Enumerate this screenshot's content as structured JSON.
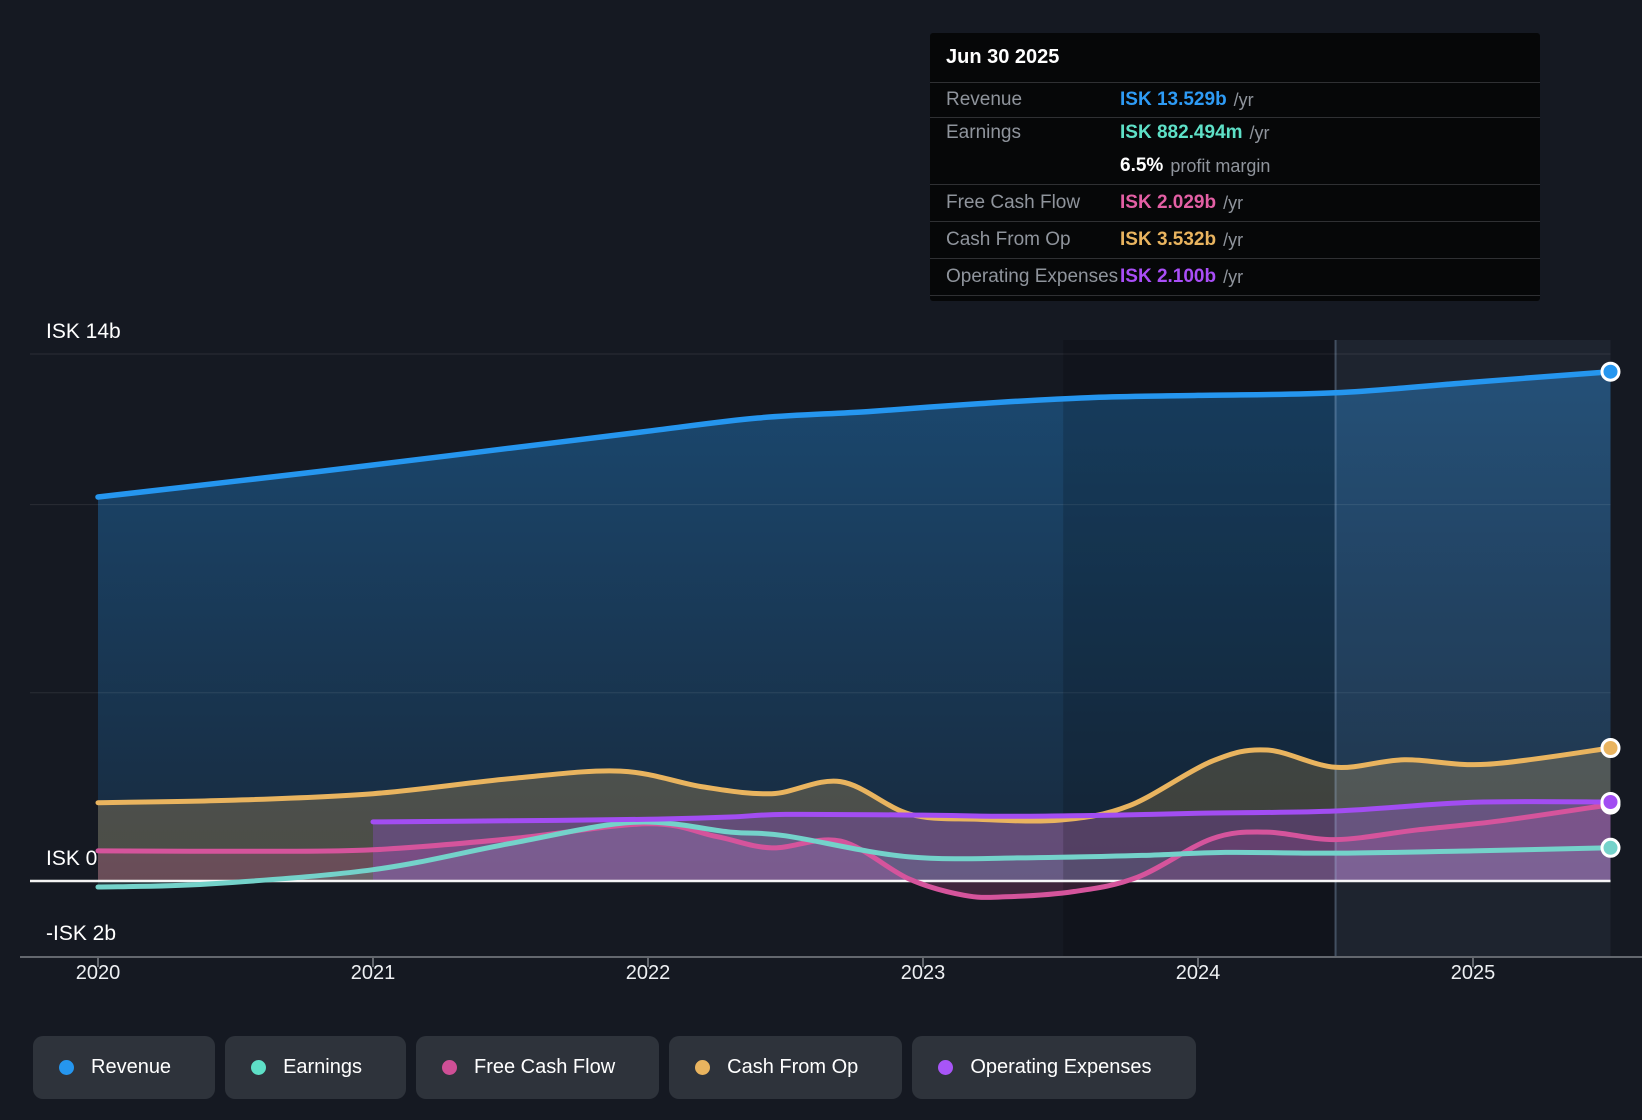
{
  "page": {
    "background": "#151922"
  },
  "tooltip": {
    "date": "Jun 30 2025",
    "rows": [
      {
        "key": "revenue",
        "label": "Revenue",
        "value": "ISK 13.529b",
        "suffix": "/yr",
        "color": "#2e9bf5"
      },
      {
        "key": "earnings",
        "label": "Earnings",
        "value": "ISK 882.494m",
        "suffix": "/yr",
        "color": "#5ee0c7"
      },
      {
        "key": "profit-margin",
        "label": "",
        "value": "6.5%",
        "suffix": "profit margin",
        "color": "#ffffff"
      },
      {
        "key": "free-cash-flow",
        "label": "Free Cash Flow",
        "value": "ISK 2.029b",
        "suffix": "/yr",
        "color": "#e35fa4"
      },
      {
        "key": "cash-from-op",
        "label": "Cash From Op",
        "value": "ISK 3.532b",
        "suffix": "/yr",
        "color": "#e9b45f"
      },
      {
        "key": "operating-expenses",
        "label": "Operating Expenses",
        "value": "ISK 2.100b",
        "suffix": "/yr",
        "color": "#a94ef7"
      }
    ]
  },
  "axis": {
    "y_labels": [
      {
        "text": "ISK 14b",
        "value": 14
      },
      {
        "text": "ISK 0",
        "value": 0
      },
      {
        "text": "-ISK 2b",
        "value": -2
      }
    ],
    "x_labels": [
      {
        "text": "2020",
        "year": 2020
      },
      {
        "text": "2021",
        "year": 2021
      },
      {
        "text": "2022",
        "year": 2022
      },
      {
        "text": "2023",
        "year": 2023
      },
      {
        "text": "2024",
        "year": 2024
      },
      {
        "text": "2025",
        "year": 2025
      }
    ]
  },
  "legend": {
    "items": [
      {
        "label": "Revenue",
        "color": "#2596ef"
      },
      {
        "label": "Earnings",
        "color": "#5ee0c7"
      },
      {
        "label": "Free Cash Flow",
        "color": "#cf4f96"
      },
      {
        "label": "Cash From Op",
        "color": "#e9b45f"
      },
      {
        "label": "Operating Expenses",
        "color": "#a855f7"
      }
    ]
  },
  "chart_data": {
    "type": "line",
    "unit": "ISK billions per year",
    "x_range": [
      2020,
      2025.5
    ],
    "ylim": [
      -2,
      14.5
    ],
    "y_gridlines": [
      14,
      10,
      5,
      0
    ],
    "grid": "horizontal-only",
    "legend_position": "bottom-left",
    "end_label_date": "Jun 30 2025",
    "highlight_band": {
      "from": 2024.5,
      "to": 2025.5
    },
    "dim_band": {
      "from": 2023.51,
      "to": 2024.5
    },
    "series": [
      {
        "name": "Revenue",
        "color": "#2596ef",
        "points": [
          [
            2020,
            10.2
          ],
          [
            2020.5,
            10.62
          ],
          [
            2021,
            11.05
          ],
          [
            2021.5,
            11.5
          ],
          [
            2022,
            11.95
          ],
          [
            2022.4,
            12.3
          ],
          [
            2022.8,
            12.47
          ],
          [
            2023.2,
            12.68
          ],
          [
            2023.6,
            12.84
          ],
          [
            2024,
            12.9
          ],
          [
            2024.5,
            12.97
          ],
          [
            2025,
            13.25
          ],
          [
            2025.5,
            13.529
          ]
        ]
      },
      {
        "name": "Cash From Op",
        "color": "#e9b45f",
        "points": [
          [
            2020,
            2.08
          ],
          [
            2020.5,
            2.15
          ],
          [
            2021,
            2.32
          ],
          [
            2021.5,
            2.72
          ],
          [
            2021.9,
            2.92
          ],
          [
            2022.2,
            2.5
          ],
          [
            2022.45,
            2.32
          ],
          [
            2022.7,
            2.64
          ],
          [
            2022.95,
            1.78
          ],
          [
            2023.2,
            1.64
          ],
          [
            2023.5,
            1.62
          ],
          [
            2023.75,
            2.0
          ],
          [
            2024.05,
            3.18
          ],
          [
            2024.25,
            3.48
          ],
          [
            2024.5,
            3.02
          ],
          [
            2024.75,
            3.22
          ],
          [
            2025.05,
            3.1
          ],
          [
            2025.5,
            3.532
          ]
        ]
      },
      {
        "name": "Free Cash Flow",
        "color": "#d5549c",
        "points": [
          [
            2020,
            0.8
          ],
          [
            2020.6,
            0.79
          ],
          [
            2021,
            0.83
          ],
          [
            2021.5,
            1.12
          ],
          [
            2022,
            1.52
          ],
          [
            2022.25,
            1.18
          ],
          [
            2022.45,
            0.88
          ],
          [
            2022.7,
            1.06
          ],
          [
            2022.95,
            0.05
          ],
          [
            2023.15,
            -0.38
          ],
          [
            2023.3,
            -0.42
          ],
          [
            2023.55,
            -0.28
          ],
          [
            2023.78,
            0.1
          ],
          [
            2024.05,
            1.12
          ],
          [
            2024.25,
            1.3
          ],
          [
            2024.5,
            1.1
          ],
          [
            2024.8,
            1.36
          ],
          [
            2025.1,
            1.6
          ],
          [
            2025.5,
            2.029
          ]
        ]
      },
      {
        "name": "Earnings",
        "color": "#74d2ca",
        "points": [
          [
            2020,
            -0.16
          ],
          [
            2020.4,
            -0.08
          ],
          [
            2021,
            0.3
          ],
          [
            2021.5,
            1.0
          ],
          [
            2021.95,
            1.56
          ],
          [
            2022.3,
            1.3
          ],
          [
            2022.5,
            1.2
          ],
          [
            2022.95,
            0.64
          ],
          [
            2023.4,
            0.62
          ],
          [
            2023.8,
            0.68
          ],
          [
            2024.1,
            0.76
          ],
          [
            2024.5,
            0.74
          ],
          [
            2025,
            0.8
          ],
          [
            2025.5,
            0.882
          ]
        ]
      },
      {
        "name": "Operating Expenses",
        "color": "#a24df2",
        "points": [
          [
            2021,
            1.57
          ],
          [
            2021.5,
            1.6
          ],
          [
            2022,
            1.64
          ],
          [
            2022.3,
            1.7
          ],
          [
            2022.5,
            1.77
          ],
          [
            2023,
            1.75
          ],
          [
            2023.3,
            1.72
          ],
          [
            2023.7,
            1.75
          ],
          [
            2024,
            1.8
          ],
          [
            2024.5,
            1.86
          ],
          [
            2025,
            2.09
          ],
          [
            2025.5,
            2.1
          ]
        ]
      }
    ]
  }
}
